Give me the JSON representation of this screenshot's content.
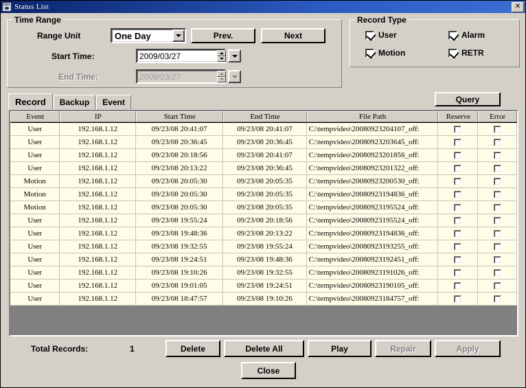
{
  "window": {
    "title": "Status List",
    "icon": "status-list-icon",
    "close_label": "✕"
  },
  "time_range": {
    "legend": "Time Range",
    "range_unit_label": "Range Unit",
    "range_unit_value": "One Day",
    "prev_label": "Prev.",
    "next_label": "Next",
    "start_time_label": "Start Time:",
    "start_time_value": "2009/03/27",
    "end_time_label": "End Time:",
    "end_time_value": "2009/03/27",
    "end_time_enabled": false
  },
  "record_type": {
    "legend": "Record Type",
    "items": [
      {
        "label": "User",
        "checked": true
      },
      {
        "label": "Alarm",
        "checked": true
      },
      {
        "label": "Motion",
        "checked": true
      },
      {
        "label": "RETR",
        "checked": true
      }
    ]
  },
  "query": {
    "label": "Query"
  },
  "tabs": [
    {
      "label": "Record",
      "selected": true
    },
    {
      "label": "Backup",
      "selected": false
    },
    {
      "label": "Event",
      "selected": false
    }
  ],
  "table": {
    "columns": [
      "Event",
      "IP",
      "Start Time",
      "End Time",
      "File Path",
      "Reserve",
      "Error"
    ],
    "rows": [
      {
        "event": "User",
        "ip": "192.168.1.12",
        "start": "09/23/08 20:41:07",
        "end": "09/23/08 20:41:07",
        "path": "C:\\tempvideo\\20080923204107_off:",
        "reserve": false,
        "error": false
      },
      {
        "event": "User",
        "ip": "192.168.1.12",
        "start": "09/23/08 20:36:45",
        "end": "09/23/08 20:36:45",
        "path": "C:\\tempvideo\\20080923203645_off:",
        "reserve": false,
        "error": false
      },
      {
        "event": "User",
        "ip": "192.168.1.12",
        "start": "09/23/08 20:18:56",
        "end": "09/23/08 20:41:07",
        "path": "C:\\tempvideo\\20080923201856_off:",
        "reserve": false,
        "error": false
      },
      {
        "event": "User",
        "ip": "192.168.1.12",
        "start": "09/23/08 20:13:22",
        "end": "09/23/08 20:36:45",
        "path": "C:\\tempvideo\\20080923201322_off:",
        "reserve": false,
        "error": false
      },
      {
        "event": "Motion",
        "ip": "192.168.1.12",
        "start": "09/23/08 20:05:30",
        "end": "09/23/08 20:05:35",
        "path": "C:\\tempvideo\\20080923200530_off:",
        "reserve": false,
        "error": false
      },
      {
        "event": "Motion",
        "ip": "192.168.1.12",
        "start": "09/23/08 20:05:30",
        "end": "09/23/08 20:05:35",
        "path": "C:\\tempvideo\\20080923194836_off:",
        "reserve": false,
        "error": false
      },
      {
        "event": "Motion",
        "ip": "192.168.1.12",
        "start": "09/23/08 20:05:30",
        "end": "09/23/08 20:05:35",
        "path": "C:\\tempvideo\\20080923195524_off:",
        "reserve": false,
        "error": false
      },
      {
        "event": "User",
        "ip": "192.168.1.12",
        "start": "09/23/08 19:55:24",
        "end": "09/23/08 20:18:56",
        "path": "C:\\tempvideo\\20080923195524_off:",
        "reserve": false,
        "error": false
      },
      {
        "event": "User",
        "ip": "192.168.1.12",
        "start": "09/23/08 19:48:36",
        "end": "09/23/08 20:13:22",
        "path": "C:\\tempvideo\\20080923194836_off:",
        "reserve": false,
        "error": false
      },
      {
        "event": "User",
        "ip": "192.168.1.12",
        "start": "09/23/08 19:32:55",
        "end": "09/23/08 19:55:24",
        "path": "C:\\tempvideo\\20080923193255_off:",
        "reserve": false,
        "error": false
      },
      {
        "event": "User",
        "ip": "192.168.1.12",
        "start": "09/23/08 19:24:51",
        "end": "09/23/08 19:48:36",
        "path": "C:\\tempvideo\\20080923192451_off:",
        "reserve": false,
        "error": false
      },
      {
        "event": "User",
        "ip": "192.168.1.12",
        "start": "09/23/08 19:10:26",
        "end": "09/23/08 19:32:55",
        "path": "C:\\tempvideo\\20080923191026_off:",
        "reserve": false,
        "error": false
      },
      {
        "event": "User",
        "ip": "192.168.1.12",
        "start": "09/23/08 19:01:05",
        "end": "09/23/08 19:24:51",
        "path": "C:\\tempvideo\\20080923190105_off:",
        "reserve": false,
        "error": false
      },
      {
        "event": "User",
        "ip": "192.168.1.12",
        "start": "09/23/08 18:47:57",
        "end": "09/23/08 19:10:26",
        "path": "C:\\tempvideo\\20080923184757_off:",
        "reserve": false,
        "error": false
      }
    ]
  },
  "footer": {
    "total_records_label": "Total Records:",
    "total_records_value": "1",
    "buttons": [
      {
        "label": "Delete",
        "enabled": true
      },
      {
        "label": "Delete All",
        "enabled": true
      },
      {
        "label": "Play",
        "enabled": true
      },
      {
        "label": "Repair",
        "enabled": false
      },
      {
        "label": "Apply",
        "enabled": false
      }
    ],
    "close_label": "Close"
  },
  "colors": {
    "face": "#d4d0c8",
    "row_bg": "#fffde8",
    "list_empty": "#808080",
    "title_left": "#0a246a",
    "title_right": "#3b6fd4"
  }
}
